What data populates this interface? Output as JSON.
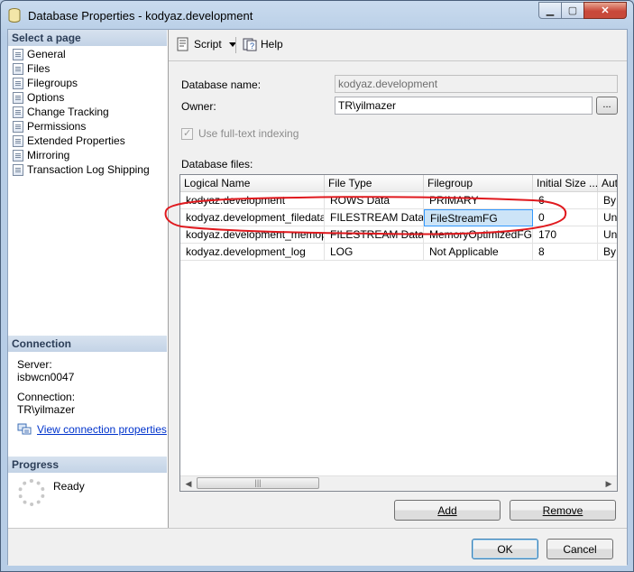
{
  "window": {
    "title": "Database Properties - kodyaz.development"
  },
  "left_panel": {
    "select_page_header": "Select a page",
    "pages": [
      {
        "label": "General"
      },
      {
        "label": "Files"
      },
      {
        "label": "Filegroups"
      },
      {
        "label": "Options"
      },
      {
        "label": "Change Tracking"
      },
      {
        "label": "Permissions"
      },
      {
        "label": "Extended Properties"
      },
      {
        "label": "Mirroring"
      },
      {
        "label": "Transaction Log Shipping"
      }
    ],
    "connection_header": "Connection",
    "server_label": "Server:",
    "server_value": "isbwcn0047",
    "connection_label": "Connection:",
    "connection_value": "TR\\yilmazer",
    "view_connection_properties": "View connection properties",
    "progress_header": "Progress",
    "progress_status": "Ready"
  },
  "toolbar": {
    "script_label": "Script",
    "help_label": "Help"
  },
  "form": {
    "database_name_label": "Database name:",
    "database_name_value": "kodyaz.development",
    "owner_label": "Owner:",
    "owner_value": "TR\\yilmazer",
    "browse_label": "...",
    "fulltext_label": "Use full-text indexing",
    "database_files_label": "Database files:"
  },
  "files_grid": {
    "columns": [
      "Logical Name",
      "File Type",
      "Filegroup",
      "Initial Size ...",
      "Auto"
    ],
    "rows": [
      [
        "kodyaz.development",
        "ROWS Data",
        "PRIMARY",
        "6",
        "By"
      ],
      [
        "kodyaz.development_filedata",
        "FILESTREAM Data",
        "FileStreamFG",
        "0",
        "Unl"
      ],
      [
        "kodyaz.development_memopt",
        "FILESTREAM Data",
        "MemoryOptimizedFG",
        "170",
        "Unl"
      ],
      [
        "kodyaz.development_log",
        "LOG",
        "Not Applicable",
        "8",
        "By"
      ]
    ],
    "selected_cell": "FileStreamFG"
  },
  "buttons": {
    "add": "Add",
    "remove": "Remove",
    "ok": "OK",
    "cancel": "Cancel"
  },
  "colors": {
    "annotation": "#e0191e",
    "link": "#0033cc",
    "selection": "#cce4f7"
  }
}
